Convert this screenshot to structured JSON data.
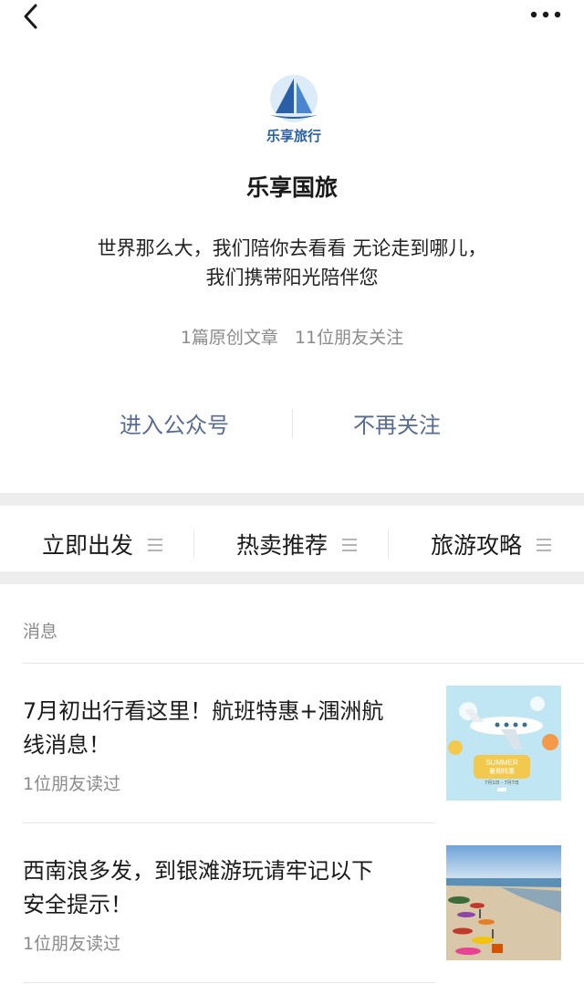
{
  "nav": {
    "back_icon": "chevron-left-icon",
    "more_icon": "more-dots-icon"
  },
  "account": {
    "logo_text": "乐享旅行",
    "name": "乐享国旅",
    "intro_line1": "世界那么大，我们陪你去看看 无论走到哪儿，",
    "intro_line2": "我们携带阳光陪伴您",
    "stats_articles": "1篇原创文章",
    "stats_friends": "11位朋友关注"
  },
  "actions": {
    "enter": "进入公众号",
    "unfollow": "不再关注"
  },
  "menu": [
    {
      "label": "立即出发",
      "icon": "menu-lines-icon"
    },
    {
      "label": "热卖推荐",
      "icon": "menu-lines-icon"
    },
    {
      "label": "旅游攻略",
      "icon": "menu-lines-icon"
    }
  ],
  "messages": {
    "title": "消息",
    "items": [
      {
        "title_line1": "7月初出行看这里！航班特惠+涠洲航",
        "title_line2": "线消息！",
        "meta": "1位朋友读过",
        "thumb_badge_en": "SUMMER",
        "thumb_badge_cn": "暑期特惠",
        "thumb_badge_date": "7月1日 - 7月7日"
      },
      {
        "title_line1": "西南浪多发，到银滩游玩请牢记以下",
        "title_line2": "安全提示！",
        "meta": "1位朋友读过"
      }
    ]
  },
  "colors": {
    "link": "#576b95",
    "muted": "#8a8a8a",
    "brand": "#2a5fa8",
    "separator": "#ededed"
  }
}
